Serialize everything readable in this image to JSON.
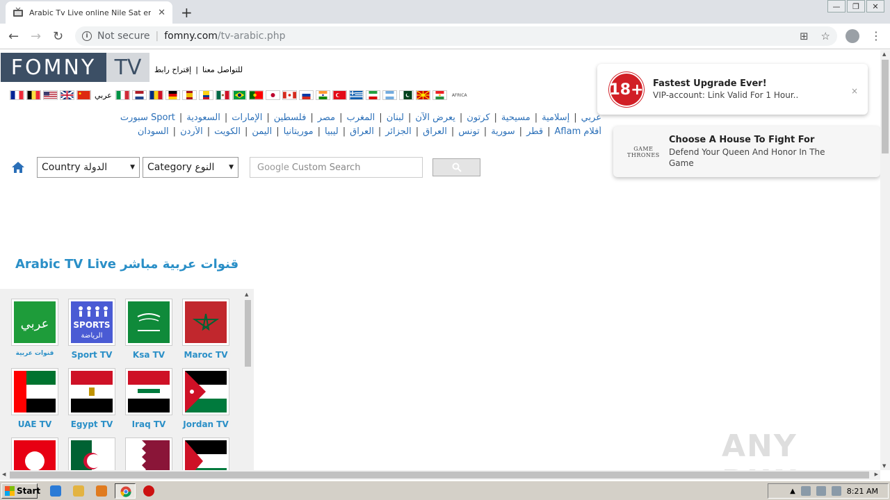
{
  "browser": {
    "tab_title": "Arabic Tv Live online Nile Sat en Dire",
    "url_secure_label": "Not secure",
    "url_host": "fomny.com",
    "url_path": "/tv-arabic.php"
  },
  "site": {
    "logo_left": "FOMNY",
    "logo_right": "TV",
    "toplink_contact": "للتواصل معنا",
    "toplink_suggest": "إقتراح رابط",
    "flag_arabic_label": "عربي",
    "africa_label": "AFRICA",
    "nav_row1": [
      "عربي",
      "إسلامية",
      "مسيحية",
      "كرتون",
      "يعرض الآن",
      "لبنان",
      "المغرب",
      "مصر",
      "فلسطين",
      "الإمارات",
      "السعودية",
      "Sport سبورت"
    ],
    "nav_row2": [
      "أفلام Aflam",
      "قطر",
      "سورية",
      "تونس",
      "العراق",
      "الجزائر",
      "العراق",
      "ليبيا",
      "موريتانيا",
      "اليمن",
      "الكويت",
      "الأردن",
      "السودان"
    ],
    "country_select": "Country الدولة",
    "category_select": "Category النوع",
    "search_google": "Google",
    "search_placeholder": "Custom Search",
    "section_title": "Arabic TV Live قنوات عربية مباشر"
  },
  "channels": [
    {
      "label": "قنوات عربية",
      "icon": "arabic-channels-icon"
    },
    {
      "label": "Sport TV",
      "icon": "sports-icon"
    },
    {
      "label": "Ksa TV",
      "icon": "saudi-flag-icon"
    },
    {
      "label": "Maroc TV",
      "icon": "morocco-flag-icon"
    },
    {
      "label": "UAE TV",
      "icon": "uae-flag-icon"
    },
    {
      "label": "Egypt TV",
      "icon": "egypt-flag-icon"
    },
    {
      "label": "Iraq TV",
      "icon": "iraq-flag-icon"
    },
    {
      "label": "Jordan TV",
      "icon": "jordan-flag-icon"
    }
  ],
  "channel_tiles": {
    "arabic_word": "عربي",
    "sports_word": "SPORTS",
    "sports_ar": "الرياضة"
  },
  "notifications": [
    {
      "badge": "18+",
      "title": "Fastest Upgrade Ever!",
      "body": "VIP-account: Link Valid For 1 Hour..",
      "close": "×"
    },
    {
      "logo_line1": "GAME",
      "logo_line2": "THRONES",
      "title": "Choose A House To Fight For",
      "body": "Defend Your Queen And Honor In The Game"
    }
  ],
  "watermark": "ANY RUN",
  "taskbar": {
    "start_label": "Start",
    "clock": "8:21 AM"
  },
  "colors": {
    "link_blue": "#2a6fb8",
    "title_blue": "#2a8fc7",
    "logo_dark": "#3c4f65",
    "badge_red": "#d11f26"
  }
}
